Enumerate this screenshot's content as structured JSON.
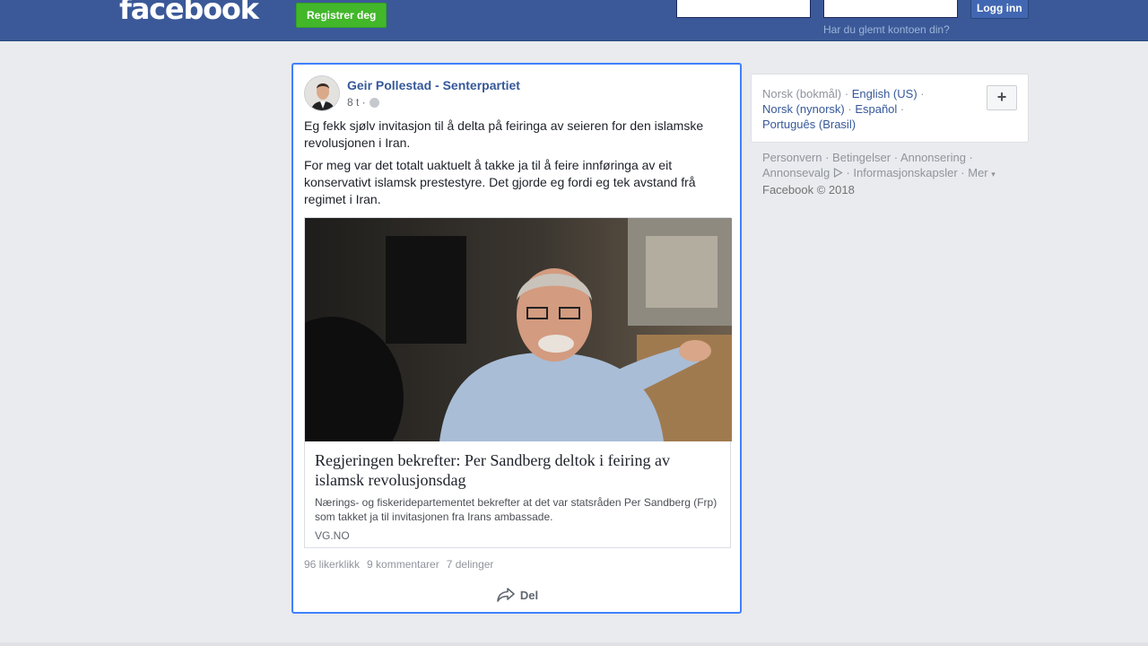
{
  "header": {
    "logo": "facebook",
    "register_label": "Registrer deg",
    "login_label": "Logg inn",
    "forgot_label": "Har du glemt kontoen din?"
  },
  "post": {
    "author": "Geir Pollestad - Senterpartiet",
    "time": "8 t ·",
    "paragraphs": [
      "Eg fekk sjølv invitasjon til å delta på feiringa av seieren for den islamske revolusjonen i Iran.",
      "For meg var det totalt uaktuelt å takke ja til å feire innføringa av eit konservativt islamsk prestestyre. Det gjorde eg fordi eg tek avstand frå regimet i Iran."
    ],
    "link": {
      "title": "Regjeringen bekrefter: Per Sandberg deltok i feiring av islamsk revolusjonsdag",
      "description": "Nærings- og fiskeridepartementet bekrefter at det var statsråden Per Sandberg (Frp) som takket ja til invitasjonen fra Irans ambassade.",
      "domain": "VG.NO"
    },
    "stats": {
      "likes": "96 likerklikk",
      "comments": "9 kommentarer",
      "shares": "7 delinger"
    },
    "share_label": "Del"
  },
  "sidebar": {
    "current_language": "Norsk (bokmål)",
    "languages": [
      "English (US)",
      "Norsk (nynorsk)",
      "Español",
      "Português (Brasil)"
    ],
    "footer_links": [
      "Personvern",
      "Betingelser",
      "Annonsering",
      "Annonsevalg",
      "Informasjonskapsler",
      "Mer"
    ],
    "copyright": "Facebook © 2018"
  },
  "colors": {
    "brand_blue": "#3b5998",
    "register_green": "#42b72a",
    "link_blue": "#365899",
    "focus_border": "#4080ff"
  }
}
